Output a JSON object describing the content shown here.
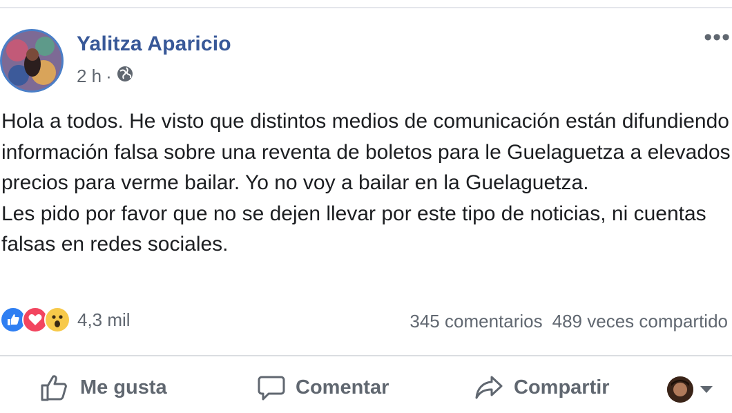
{
  "post": {
    "author": "Yalitza Aparicio",
    "time": "2 h",
    "separator": "·",
    "privacy_icon": "globe-icon",
    "more_icon": "more-horizontal-icon",
    "paragraphs": [
      "Hola a todos. He visto que distintos medios de comunicación están difundiendo información falsa sobre una reventa de boletos para le Guelaguetza a elevados precios para verme bailar. Yo no voy a bailar en la Guelaguetza.",
      "Les pido por favor que no se dejen llevar por este tipo de noticias, ni cuentas falsas en redes sociales."
    ],
    "reactions": {
      "icons": [
        "like-reaction-icon",
        "love-reaction-icon",
        "wow-reaction-icon"
      ],
      "count": "4,3 mil"
    },
    "comments": "345 comentarios",
    "shares": "489 veces compartido",
    "actions": {
      "like": "Me gusta",
      "comment": "Comentar",
      "share": "Compartir"
    },
    "colors": {
      "author": "#385898",
      "meta": "#606770",
      "like": "#2f7ff2",
      "love": "#f2455f",
      "wow": "#f7c94a"
    }
  }
}
